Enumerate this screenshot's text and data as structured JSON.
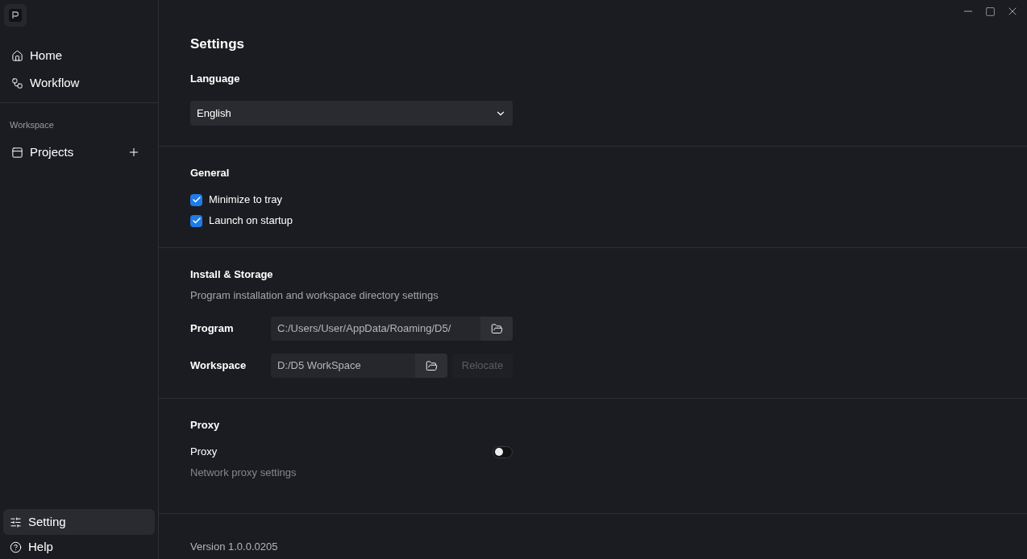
{
  "sidebar": {
    "top_items": [
      {
        "label": "Home",
        "selected": false
      },
      {
        "label": "Workflow",
        "selected": false
      }
    ],
    "section_label": "Workspace",
    "projects": {
      "label": "Projects",
      "selected": false
    },
    "bottom_items": [
      {
        "label": "Setting",
        "selected": true
      },
      {
        "label": "Help",
        "selected": false
      }
    ]
  },
  "title": "Settings",
  "language": {
    "heading": "Language",
    "value": "English"
  },
  "general": {
    "heading": "General",
    "options": [
      {
        "label": "Minimize to tray",
        "checked": true
      },
      {
        "label": "Launch on startup",
        "checked": true
      }
    ]
  },
  "storage": {
    "heading": "Install & Storage",
    "description": "Program installation and workspace directory settings",
    "paths": [
      {
        "label": "Program",
        "value": "C:/Users/User/AppData/Roaming/D5/"
      },
      {
        "label": "Workspace",
        "value": "D:/D5 WorkSpace",
        "action": "Relocate",
        "action_disabled": true
      }
    ]
  },
  "proxy": {
    "heading": "Proxy",
    "label": "Proxy",
    "on": false,
    "description": "Network proxy settings"
  },
  "version": "Version 1.0.0.0205"
}
